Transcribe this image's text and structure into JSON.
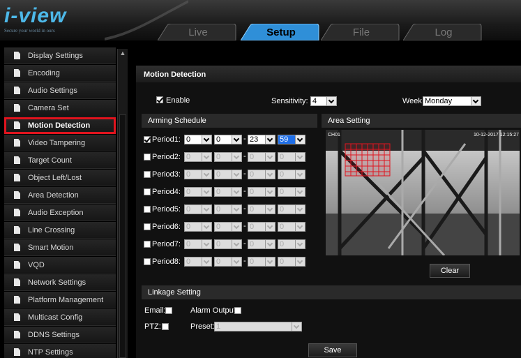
{
  "brand": {
    "logo": "i-view",
    "tagline": "Secure your world in ours"
  },
  "tabs": [
    {
      "label": "Live",
      "active": false
    },
    {
      "label": "Setup",
      "active": true
    },
    {
      "label": "File",
      "active": false
    },
    {
      "label": "Log",
      "active": false
    }
  ],
  "sidebar": {
    "items": [
      {
        "label": "Display Settings"
      },
      {
        "label": "Encoding"
      },
      {
        "label": "Audio Settings"
      },
      {
        "label": "Camera Set"
      },
      {
        "label": "Motion Detection",
        "active": true
      },
      {
        "label": "Video Tampering"
      },
      {
        "label": "Target Count"
      },
      {
        "label": "Object Left/Lost"
      },
      {
        "label": "Area Detection"
      },
      {
        "label": "Audio Exception"
      },
      {
        "label": "Line Crossing"
      },
      {
        "label": "Smart Motion"
      },
      {
        "label": "VQD"
      },
      {
        "label": "Network Settings"
      },
      {
        "label": "Platform Management"
      },
      {
        "label": "Multicast Config"
      },
      {
        "label": "DDNS Settings"
      },
      {
        "label": "NTP Settings"
      }
    ]
  },
  "main": {
    "title": "Motion Detection",
    "enable_label": "Enable",
    "sensitivity_label": "Sensitivity:",
    "sensitivity_value": "4",
    "week_label": "Week",
    "week_value": "Monday",
    "arming_schedule_label": "Arming Schedule",
    "area_setting_label": "Area Setting",
    "periods": [
      {
        "label": "Period1:",
        "checked": true,
        "start_h": "0",
        "start_m": "0",
        "end_h": "23",
        "end_m": "59"
      },
      {
        "label": "Period2:",
        "checked": false,
        "start_h": "0",
        "start_m": "0",
        "end_h": "0",
        "end_m": "0"
      },
      {
        "label": "Period3:",
        "checked": false,
        "start_h": "0",
        "start_m": "0",
        "end_h": "0",
        "end_m": "0"
      },
      {
        "label": "Period4:",
        "checked": false,
        "start_h": "0",
        "start_m": "0",
        "end_h": "0",
        "end_m": "0"
      },
      {
        "label": "Period5:",
        "checked": false,
        "start_h": "0",
        "start_m": "0",
        "end_h": "0",
        "end_m": "0"
      },
      {
        "label": "Period6:",
        "checked": false,
        "start_h": "0",
        "start_m": "0",
        "end_h": "0",
        "end_m": "0"
      },
      {
        "label": "Period7:",
        "checked": false,
        "start_h": "0",
        "start_m": "0",
        "end_h": "0",
        "end_m": "0"
      },
      {
        "label": "Period8:",
        "checked": false,
        "start_h": "0",
        "start_m": "0",
        "end_h": "0",
        "end_m": "0"
      }
    ],
    "video": {
      "channel": "CH01",
      "timestamp": "10-12-2017 12:15:27"
    },
    "clear_label": "Clear",
    "linkage_label": "Linkage Setting",
    "email_label": "Email:",
    "alarm_output_label": "Alarm Output:",
    "ptz_label": "PTZ:",
    "preset_label": "Preset:",
    "preset_value": "1",
    "save_label": "Save"
  },
  "colors": {
    "accent": "#4db8e8",
    "highlight": "#e0141e",
    "selected": "#1e6ee8"
  }
}
